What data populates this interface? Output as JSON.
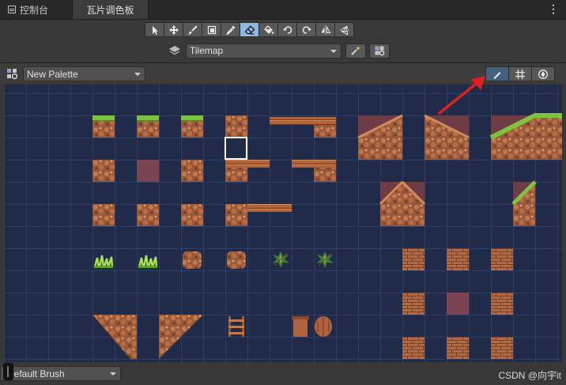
{
  "tabs": [
    {
      "label": "控制台",
      "icon": "console-icon"
    },
    {
      "label": "瓦片调色板",
      "active": true
    }
  ],
  "window_menu_icon": "kebab-menu-icon",
  "tools": [
    {
      "name": "select-tool",
      "icon": "arrow-pointer-icon"
    },
    {
      "name": "move-tool",
      "icon": "move-arrows-icon"
    },
    {
      "name": "paint-tool",
      "icon": "paintbrush-icon"
    },
    {
      "name": "box-fill-tool",
      "icon": "box-fill-icon"
    },
    {
      "name": "pick-tool",
      "icon": "eyedropper-icon"
    },
    {
      "name": "erase-tool",
      "icon": "eraser-icon",
      "active": true
    },
    {
      "name": "flood-fill-tool",
      "icon": "paint-bucket-icon"
    },
    {
      "name": "rotate-ccw-tool",
      "icon": "rotate-left-icon"
    },
    {
      "name": "rotate-cw-tool",
      "icon": "rotate-right-icon"
    },
    {
      "name": "flip-x-tool",
      "icon": "flip-horizontal-icon"
    },
    {
      "name": "flip-y-tool",
      "icon": "flip-vertical-icon"
    }
  ],
  "active_target": {
    "value": "Tilemap",
    "icon": "layers-icon"
  },
  "palette": {
    "value": "New Palette",
    "icon": "palette-icon"
  },
  "edit_buttons": [
    {
      "name": "edit-palette-button",
      "icon": "pencil-icon",
      "active": true
    },
    {
      "name": "grid-toggle-button",
      "icon": "grid-icon"
    },
    {
      "name": "gizmos-toggle-button",
      "icon": "gizmo-icon"
    }
  ],
  "brush": {
    "value": "Default Brush"
  },
  "watermark": "CSDN @向宇it",
  "colors": {
    "accent": "#8fb7e6",
    "grid_bg": "#1f2b48",
    "arrow": "#e02020"
  }
}
